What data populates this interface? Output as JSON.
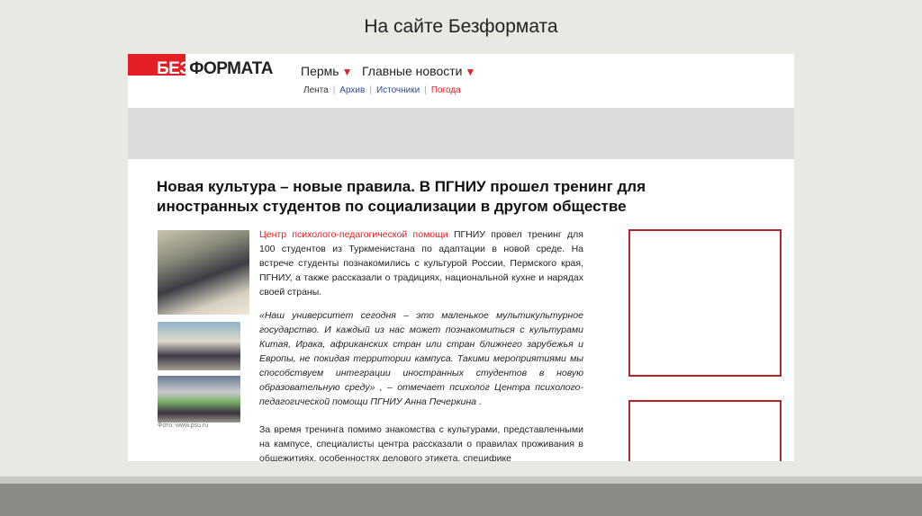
{
  "slide": {
    "title": "На сайте Безформата"
  },
  "site": {
    "logo_prefix": "БЕЗ",
    "logo_suffix": "ФОРМАТА",
    "region": "Пермь",
    "news_menu": "Главные новости",
    "subnav": [
      "Лента",
      "Архив",
      "Источники",
      "Погода"
    ]
  },
  "article": {
    "headline": "Новая культура – новые правила. В ПГНИУ прошел тренинг для иностранных студентов по социализации в другом обществе",
    "p1_link": "Центр психолого-педагогической помощи",
    "p1_rest": " ПГНИУ провел тренинг для 100 студентов из Туркменистана по адаптации в новой среде. На встрече студенты познакомились с культурой России, Пермского края, ПГНИУ, а также рассказали о традициях, национальной кухне и нарядах своей страны.",
    "p2": "«Наш университет сегодня – это маленькое мультикультурное государство. И каждый из нас может познакомиться с культурами Китая, Ирака, африканских стран или стран ближнего зарубежья и Европы, не покидая территории кампуса. Такими мероприятиями мы способствуем интеграции иностранных студентов в новую образовательную среду» , – отмечает психолог Центра психолого-педагогической помощи ПГНИУ Анна Печеркина .",
    "p3": "За время тренинга помимо знакомства с культурами, представленными на кампусе, специалисты центра рассказали о правилах проживания в общежитиях, особенностях делового этикета, специфике",
    "photo_caption": "Фото: www.psu.ru"
  },
  "colors": {
    "brand_red": "#e31e24",
    "ad_border": "#b3262a",
    "link_blue": "#2b4c9c"
  }
}
